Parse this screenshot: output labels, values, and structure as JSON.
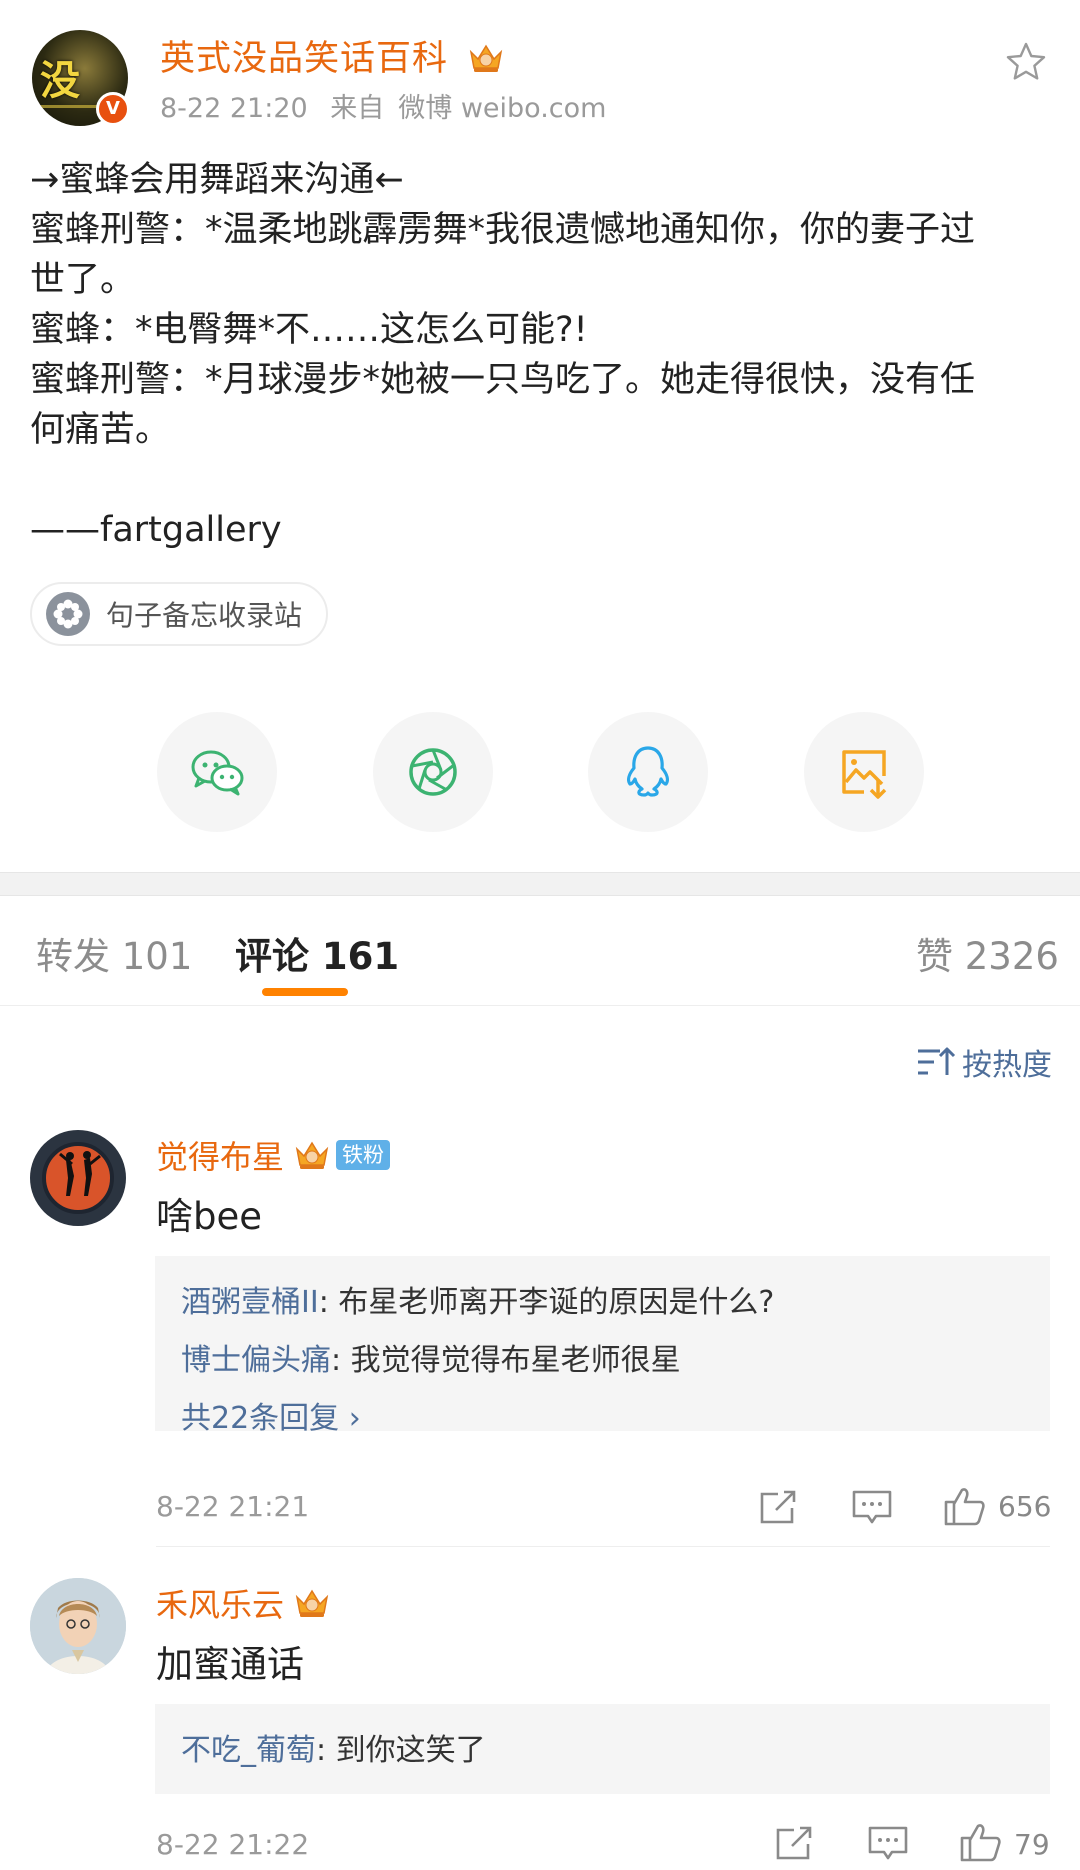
{
  "post": {
    "author": "英式没品笑话百科",
    "avatar_glyph": "没",
    "verified_mark": "V",
    "time": "8-22 21:20",
    "source_prefix": "来自",
    "source": "微博 weibo.com",
    "lines": [
      "→蜜蜂会用舞蹈来沟通←",
      "蜜蜂刑警：*温柔地跳霹雳舞*我很遗憾地通知你，你的妻子过",
      "世了。",
      "蜜蜂：*电臀舞*不……这怎么可能?!",
      "蜜蜂刑警：*月球漫步*她被一只鸟吃了。她走得很快，没有任",
      "何痛苦。",
      "",
      "——fartgallery"
    ],
    "topic": "句子备忘收录站"
  },
  "share": [
    {
      "name": "wechat-icon",
      "color": "#3cb371"
    },
    {
      "name": "moments-icon",
      "color": "#3cb371"
    },
    {
      "name": "qq-icon",
      "color": "#2aa7e8"
    },
    {
      "name": "save-image-icon",
      "color": "#f5a623"
    }
  ],
  "tabs": {
    "repost": "转发 101",
    "comment": "评论 161",
    "like": "赞 2326"
  },
  "sort": {
    "label": "按热度"
  },
  "comments": [
    {
      "user": "觉得布星",
      "badge": "铁粉",
      "text": "啥bee",
      "replies": [
        {
          "user": "酒粥壹桶II",
          "text": ": 布星老师离开李诞的原因是什么?"
        },
        {
          "user": "博士偏头痛",
          "text": ": 我觉得觉得布星老师很星"
        }
      ],
      "more": "共22条回复",
      "time": "8-22 21:21",
      "likes": "656"
    },
    {
      "user": "禾风乐云",
      "text": "加蜜通话",
      "replies": [
        {
          "user": "不吃_葡萄",
          "text": ": 到你这笑了"
        }
      ],
      "time": "8-22 21:22",
      "likes": "79"
    }
  ],
  "colors": {
    "accent": "#ff8200",
    "username": "#e8680f",
    "link": "#4e6e9a"
  }
}
